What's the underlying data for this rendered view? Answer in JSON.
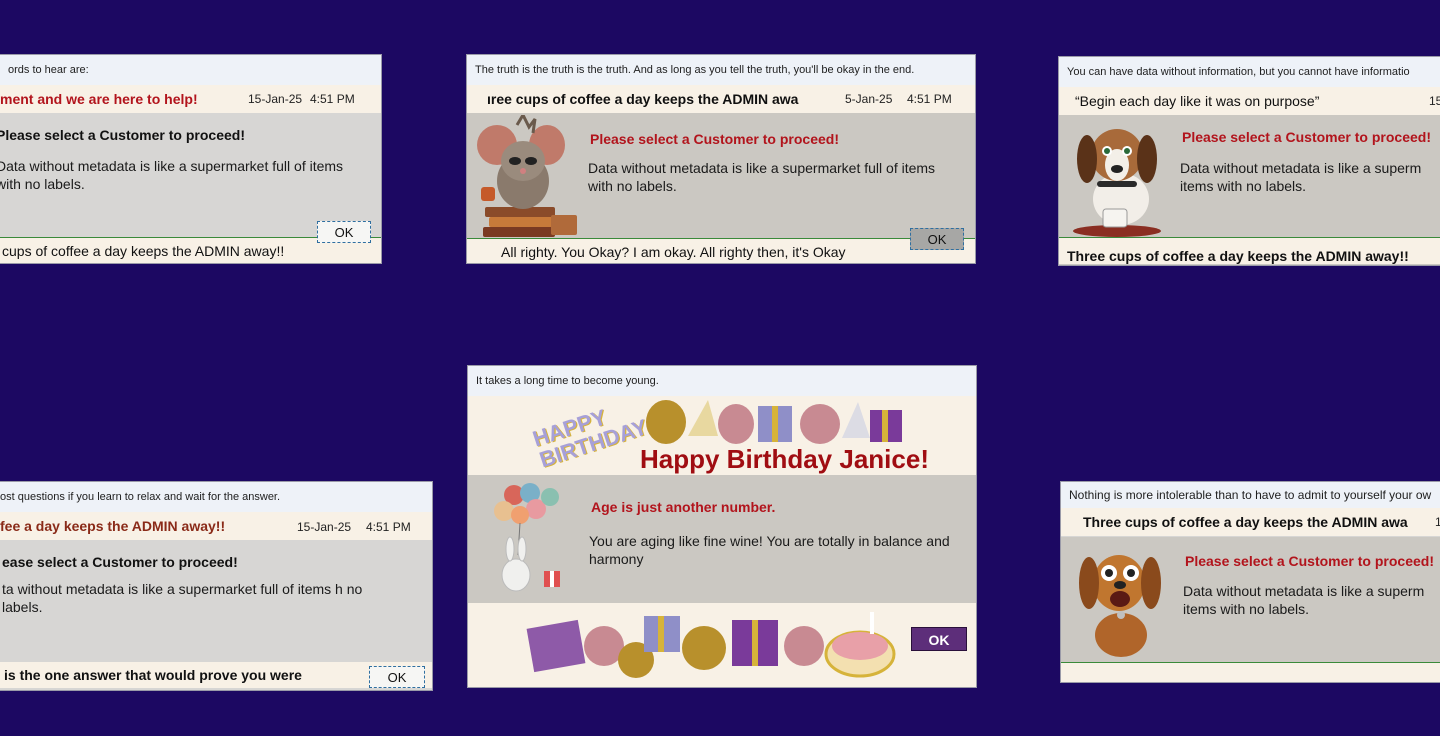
{
  "dialogs": {
    "d1": {
      "quote": "ords to hear are:",
      "scroll": "ment and we are here to help!",
      "date": "15-Jan-25",
      "time": "4:51 PM",
      "alert": "Please select a Customer to proceed!",
      "message": "Data without metadata is like a supermarket full of items with no labels.",
      "footer": "cups of coffee a day keeps the ADMIN away!!",
      "ok": "OK"
    },
    "d2": {
      "quote": "The truth is the truth is the truth. And as long as you tell the truth, you'll be okay in the end.",
      "scroll": "ıree cups of coffee a day keeps the ADMIN awa",
      "date": "5-Jan-25",
      "time": "4:51 PM",
      "alert": "Please select a Customer to proceed!",
      "message": "Data without metadata is like a supermarket full of items with no labels.",
      "footer": "All righty. You Okay? I am okay. All righty then, it's Okay",
      "ok": "OK"
    },
    "d3": {
      "quote": "You can have data without information, but you cannot have informatio",
      "scroll": "“Begin each day like it was on purpose”",
      "date": "15",
      "alert": "Please select a Customer to proceed!",
      "message": "Data without metadata is like a superm items with no labels.",
      "footer": "Three cups of coffee a day keeps the ADMIN away!!"
    },
    "d4": {
      "quote": "ost questions if you learn to relax and wait for the answer.",
      "scroll": "fee a day keeps the ADMIN away!!",
      "date": "15-Jan-25",
      "time": "4:51 PM",
      "alert": "ease select a Customer to proceed!",
      "message": "ta without metadata is like a supermarket full of items h no labels.",
      "footer": "is the one answer that would prove you were",
      "ok": "OK"
    },
    "d5": {
      "quote": "It takes a long time to become young.",
      "happy_birthday_art": "HAPPY BIRTHDAY",
      "title": "Happy Birthday Janice!",
      "alert": "Age is just another number.",
      "message": "You are aging like fine wine!  You are totally in balance and harmony",
      "ok": "OK"
    },
    "d6": {
      "quote": "Nothing is more intolerable than to have to admit to yourself your ow",
      "scroll": "Three cups of coffee a day keeps the ADMIN awa",
      "date": "1",
      "alert": "Please select a Customer to proceed!",
      "message": "Data without metadata is like a superm items with no labels."
    }
  },
  "colors": {
    "background": "#1c0862",
    "alert_red": "#b2141c",
    "title_red": "#a00d12",
    "ok_purple": "#5d2e7a"
  }
}
